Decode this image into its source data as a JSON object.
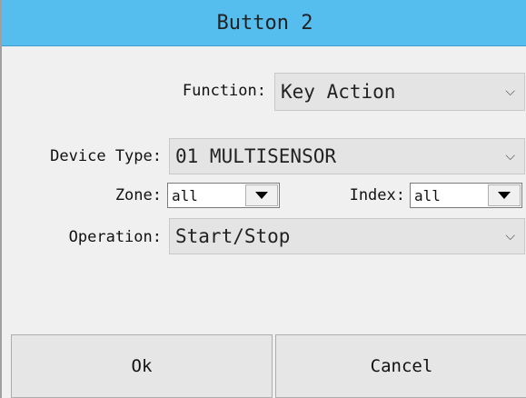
{
  "dialog": {
    "title": "Button 2"
  },
  "function": {
    "label": "Function:",
    "value": "Key Action"
  },
  "device_type": {
    "label": "Device Type:",
    "value": "01 MULTISENSOR"
  },
  "zone": {
    "label": "Zone:",
    "value": "all"
  },
  "index": {
    "label": "Index:",
    "value": "all"
  },
  "operation": {
    "label": "Operation:",
    "value": "Start/Stop"
  },
  "buttons": {
    "ok": "Ok",
    "cancel": "Cancel"
  },
  "icons": {
    "dropdown_chevron": "chevron-down-icon",
    "dropdown_arrow": "triangle-down-icon"
  },
  "colors": {
    "title_bar": "#56bdef",
    "background": "#f0f0f0"
  }
}
